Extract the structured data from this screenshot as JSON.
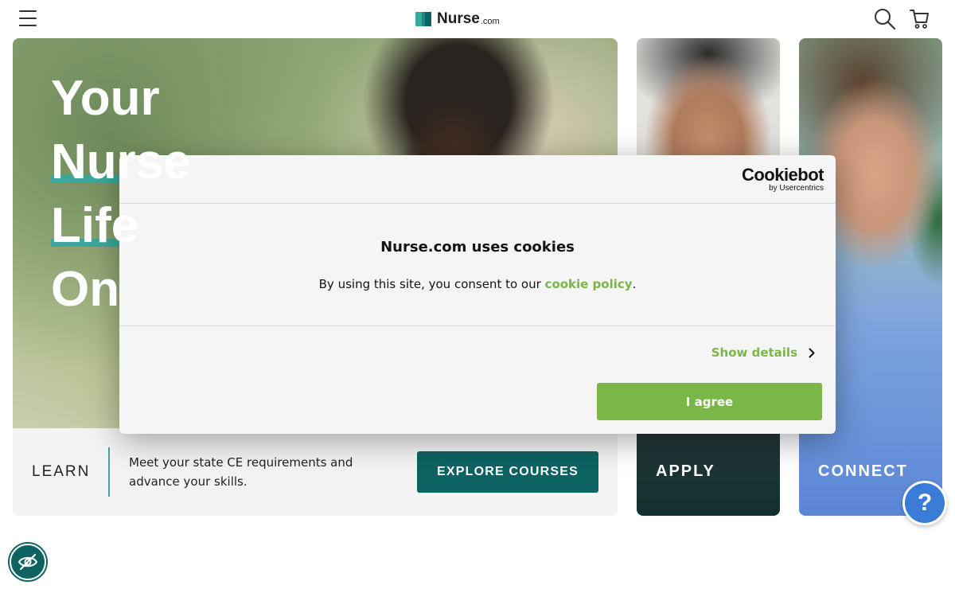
{
  "header": {
    "logo_text": "Nurse",
    "logo_suffix": ".com"
  },
  "hero": {
    "title_lines": [
      "Your",
      "Nurse",
      "Life",
      "On"
    ]
  },
  "learn": {
    "label": "LEARN",
    "description": "Meet your state CE requirements and advance your skills.",
    "button_label": "EXPLORE COURSES"
  },
  "cards": {
    "apply_label": "APPLY",
    "connect_label": "CONNECT"
  },
  "help": {
    "label": "?"
  },
  "cookie_dialog": {
    "brand_main": "Cookiebot",
    "brand_sub": "by Usercentrics",
    "title": "Nurse.com uses cookies",
    "text_prefix": "By using this site, you consent to our ",
    "link_text": "cookie policy",
    "text_suffix": ".",
    "show_details_label": "Show details",
    "agree_label": "I agree"
  },
  "colors": {
    "accent_teal": "#0d6262",
    "highlight_teal": "#3aa99a",
    "cookiebot_green": "#7ab648",
    "help_blue": "#3a7bd5"
  },
  "icons": [
    "menu-icon",
    "logo-mark-icon",
    "search-icon",
    "cart-icon",
    "chevron-right-icon",
    "eye-slash-icon"
  ]
}
